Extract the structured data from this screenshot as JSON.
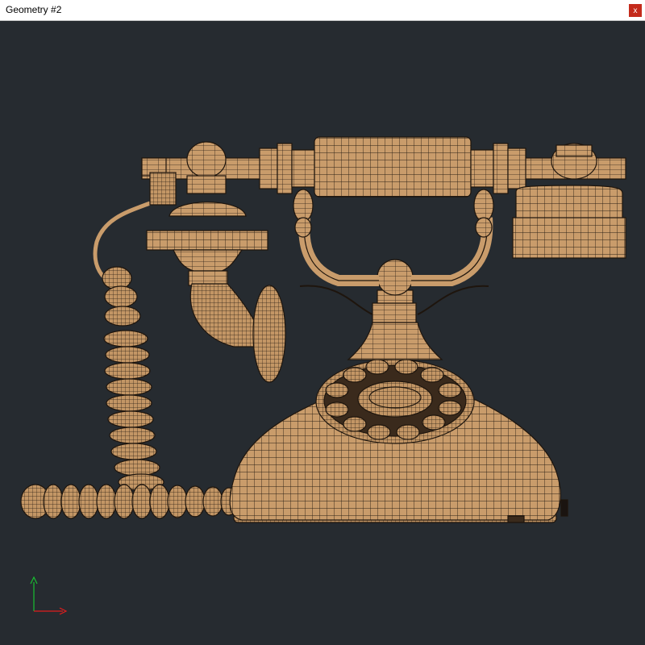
{
  "window": {
    "title": "Geometry #2",
    "close_label": "x"
  },
  "viewport": {
    "background": "#262b30",
    "model": "vintage-rotary-telephone-wireframe",
    "material_color": "#c99c6b",
    "wire_color": "#2a1f15",
    "axis_x_color": "#e01e1e",
    "axis_y_color": "#18c030"
  }
}
